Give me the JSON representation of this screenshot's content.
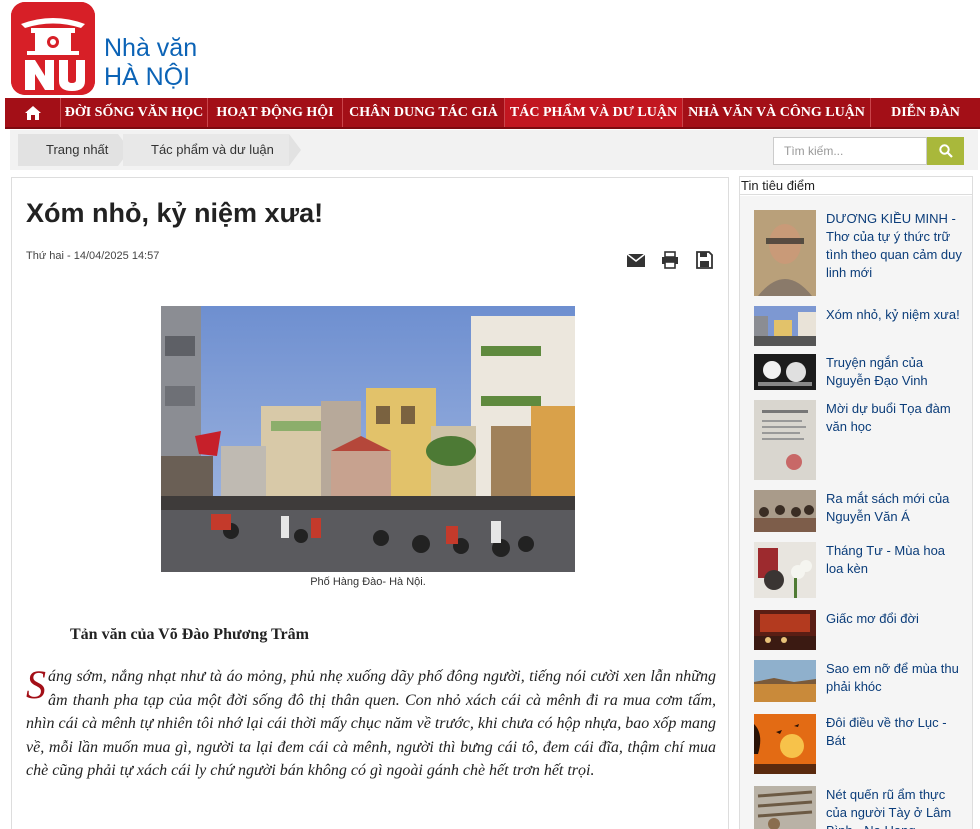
{
  "header": {
    "logo_mark": "NV",
    "logo_line1": "Nhà văn",
    "logo_line2": "HÀ NỘI"
  },
  "nav": {
    "home_icon": "home-icon",
    "items": [
      {
        "label": "ĐỜI SỐNG VĂN HỌC"
      },
      {
        "label": "HOẠT ĐỘNG HỘI"
      },
      {
        "label": "CHÂN DUNG TÁC GIẢ"
      },
      {
        "label": "TÁC PHẨM VÀ DƯ LUẬN"
      },
      {
        "label": "NHÀ VĂN VÀ CÔNG LUẬN"
      },
      {
        "label": "DIỄN ĐÀN"
      }
    ],
    "active_index": 3
  },
  "breadcrumb": {
    "items": [
      "Trang nhất",
      "Tác phẩm và dư luận"
    ]
  },
  "search": {
    "placeholder": "Tìm kiếm...",
    "button_icon": "search-icon"
  },
  "article": {
    "title": "Xóm nhỏ, kỷ niệm xưa!",
    "date": "Thứ hai - 14/04/2025 14:57",
    "tools": [
      "email-icon",
      "print-icon",
      "save-icon"
    ],
    "caption": "Phố Hàng Đào- Hà Nội.",
    "byline": "Tản văn của Võ Đào Phương Trâm",
    "dropcap": "S",
    "paragraph": "áng sớm, nắng nhạt như tà áo mỏng, phủ nhẹ xuống dãy phố đông người, tiếng nói cười xen lẫn những âm thanh pha tạp của một đời sống đô thị thân quen. Con nhỏ xách cái cà mênh đi ra mua cơm tấm, nhìn cái cà mênh tự nhiên tôi nhớ lại cái thời mấy chục năm về trước, khi chưa có hộp nhựa, bao xốp mang về, mỗi lần muốn mua gì, người ta lại đem cái cà mênh, người thì bưng cái tô, đem cái đĩa, thậm chí mua chè cũng phải tự xách cái ly chứ người bán không có gì ngoài gánh chè hết trơn hết trọi."
  },
  "sidebar": {
    "heading": "Tin tiêu điểm",
    "items": [
      {
        "title": "DƯƠNG KIỀU MINH - Thơ của tự ý thức trữ tình theo quan cảm duy linh mới"
      },
      {
        "title": "Xóm nhỏ, kỷ niệm xưa!"
      },
      {
        "title": "Truyện ngắn của Nguyễn Đạo Vinh"
      },
      {
        "title": "Mời dự buổi Tọa đàm văn học"
      },
      {
        "title": "Ra mắt sách mới của Nguyễn Văn Á"
      },
      {
        "title": "Tháng Tư - Mùa hoa loa kèn"
      },
      {
        "title": "Giấc mơ đổi đời"
      },
      {
        "title": "Sao em nỡ để mùa thu phải khóc"
      },
      {
        "title": "Đôi điều về thơ Lục - Bát"
      },
      {
        "title": "Nét quến rũ ẩm thực của người Tày ở Lâm Bình - Na Hang"
      }
    ]
  },
  "colors": {
    "brand_red": "#a30f17",
    "logo_red": "#d71f27",
    "logo_blue": "#0b63b6",
    "search_green": "#a9b83b",
    "link_blue": "#0b3d7a"
  }
}
